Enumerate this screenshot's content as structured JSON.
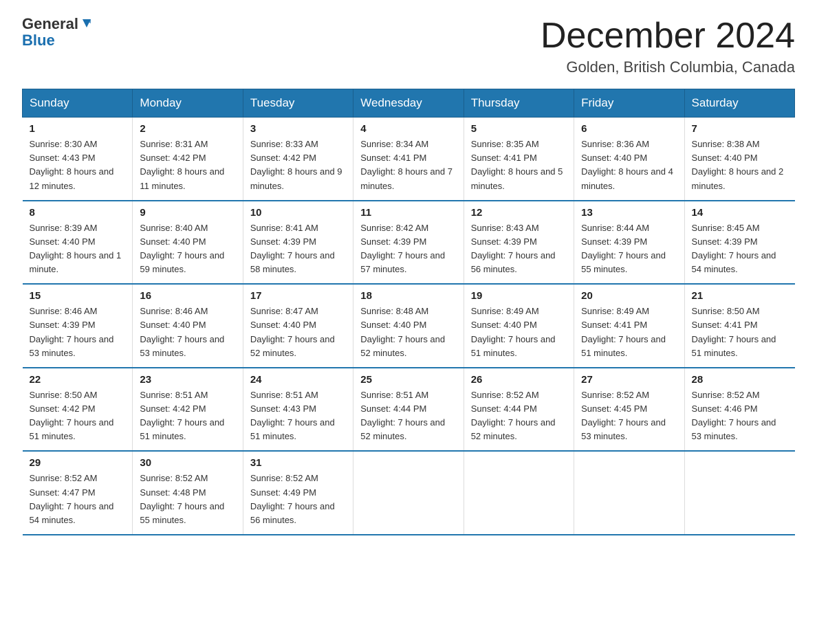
{
  "logo": {
    "general": "General",
    "arrow": "▶",
    "blue": "Blue"
  },
  "title": "December 2024",
  "location": "Golden, British Columbia, Canada",
  "days_of_week": [
    "Sunday",
    "Monday",
    "Tuesday",
    "Wednesday",
    "Thursday",
    "Friday",
    "Saturday"
  ],
  "weeks": [
    [
      {
        "day": "1",
        "sunrise": "8:30 AM",
        "sunset": "4:43 PM",
        "daylight": "8 hours and 12 minutes."
      },
      {
        "day": "2",
        "sunrise": "8:31 AM",
        "sunset": "4:42 PM",
        "daylight": "8 hours and 11 minutes."
      },
      {
        "day": "3",
        "sunrise": "8:33 AM",
        "sunset": "4:42 PM",
        "daylight": "8 hours and 9 minutes."
      },
      {
        "day": "4",
        "sunrise": "8:34 AM",
        "sunset": "4:41 PM",
        "daylight": "8 hours and 7 minutes."
      },
      {
        "day": "5",
        "sunrise": "8:35 AM",
        "sunset": "4:41 PM",
        "daylight": "8 hours and 5 minutes."
      },
      {
        "day": "6",
        "sunrise": "8:36 AM",
        "sunset": "4:40 PM",
        "daylight": "8 hours and 4 minutes."
      },
      {
        "day": "7",
        "sunrise": "8:38 AM",
        "sunset": "4:40 PM",
        "daylight": "8 hours and 2 minutes."
      }
    ],
    [
      {
        "day": "8",
        "sunrise": "8:39 AM",
        "sunset": "4:40 PM",
        "daylight": "8 hours and 1 minute."
      },
      {
        "day": "9",
        "sunrise": "8:40 AM",
        "sunset": "4:40 PM",
        "daylight": "7 hours and 59 minutes."
      },
      {
        "day": "10",
        "sunrise": "8:41 AM",
        "sunset": "4:39 PM",
        "daylight": "7 hours and 58 minutes."
      },
      {
        "day": "11",
        "sunrise": "8:42 AM",
        "sunset": "4:39 PM",
        "daylight": "7 hours and 57 minutes."
      },
      {
        "day": "12",
        "sunrise": "8:43 AM",
        "sunset": "4:39 PM",
        "daylight": "7 hours and 56 minutes."
      },
      {
        "day": "13",
        "sunrise": "8:44 AM",
        "sunset": "4:39 PM",
        "daylight": "7 hours and 55 minutes."
      },
      {
        "day": "14",
        "sunrise": "8:45 AM",
        "sunset": "4:39 PM",
        "daylight": "7 hours and 54 minutes."
      }
    ],
    [
      {
        "day": "15",
        "sunrise": "8:46 AM",
        "sunset": "4:39 PM",
        "daylight": "7 hours and 53 minutes."
      },
      {
        "day": "16",
        "sunrise": "8:46 AM",
        "sunset": "4:40 PM",
        "daylight": "7 hours and 53 minutes."
      },
      {
        "day": "17",
        "sunrise": "8:47 AM",
        "sunset": "4:40 PM",
        "daylight": "7 hours and 52 minutes."
      },
      {
        "day": "18",
        "sunrise": "8:48 AM",
        "sunset": "4:40 PM",
        "daylight": "7 hours and 52 minutes."
      },
      {
        "day": "19",
        "sunrise": "8:49 AM",
        "sunset": "4:40 PM",
        "daylight": "7 hours and 51 minutes."
      },
      {
        "day": "20",
        "sunrise": "8:49 AM",
        "sunset": "4:41 PM",
        "daylight": "7 hours and 51 minutes."
      },
      {
        "day": "21",
        "sunrise": "8:50 AM",
        "sunset": "4:41 PM",
        "daylight": "7 hours and 51 minutes."
      }
    ],
    [
      {
        "day": "22",
        "sunrise": "8:50 AM",
        "sunset": "4:42 PM",
        "daylight": "7 hours and 51 minutes."
      },
      {
        "day": "23",
        "sunrise": "8:51 AM",
        "sunset": "4:42 PM",
        "daylight": "7 hours and 51 minutes."
      },
      {
        "day": "24",
        "sunrise": "8:51 AM",
        "sunset": "4:43 PM",
        "daylight": "7 hours and 51 minutes."
      },
      {
        "day": "25",
        "sunrise": "8:51 AM",
        "sunset": "4:44 PM",
        "daylight": "7 hours and 52 minutes."
      },
      {
        "day": "26",
        "sunrise": "8:52 AM",
        "sunset": "4:44 PM",
        "daylight": "7 hours and 52 minutes."
      },
      {
        "day": "27",
        "sunrise": "8:52 AM",
        "sunset": "4:45 PM",
        "daylight": "7 hours and 53 minutes."
      },
      {
        "day": "28",
        "sunrise": "8:52 AM",
        "sunset": "4:46 PM",
        "daylight": "7 hours and 53 minutes."
      }
    ],
    [
      {
        "day": "29",
        "sunrise": "8:52 AM",
        "sunset": "4:47 PM",
        "daylight": "7 hours and 54 minutes."
      },
      {
        "day": "30",
        "sunrise": "8:52 AM",
        "sunset": "4:48 PM",
        "daylight": "7 hours and 55 minutes."
      },
      {
        "day": "31",
        "sunrise": "8:52 AM",
        "sunset": "4:49 PM",
        "daylight": "7 hours and 56 minutes."
      },
      null,
      null,
      null,
      null
    ]
  ],
  "labels": {
    "sunrise": "Sunrise:",
    "sunset": "Sunset:",
    "daylight": "Daylight:"
  }
}
